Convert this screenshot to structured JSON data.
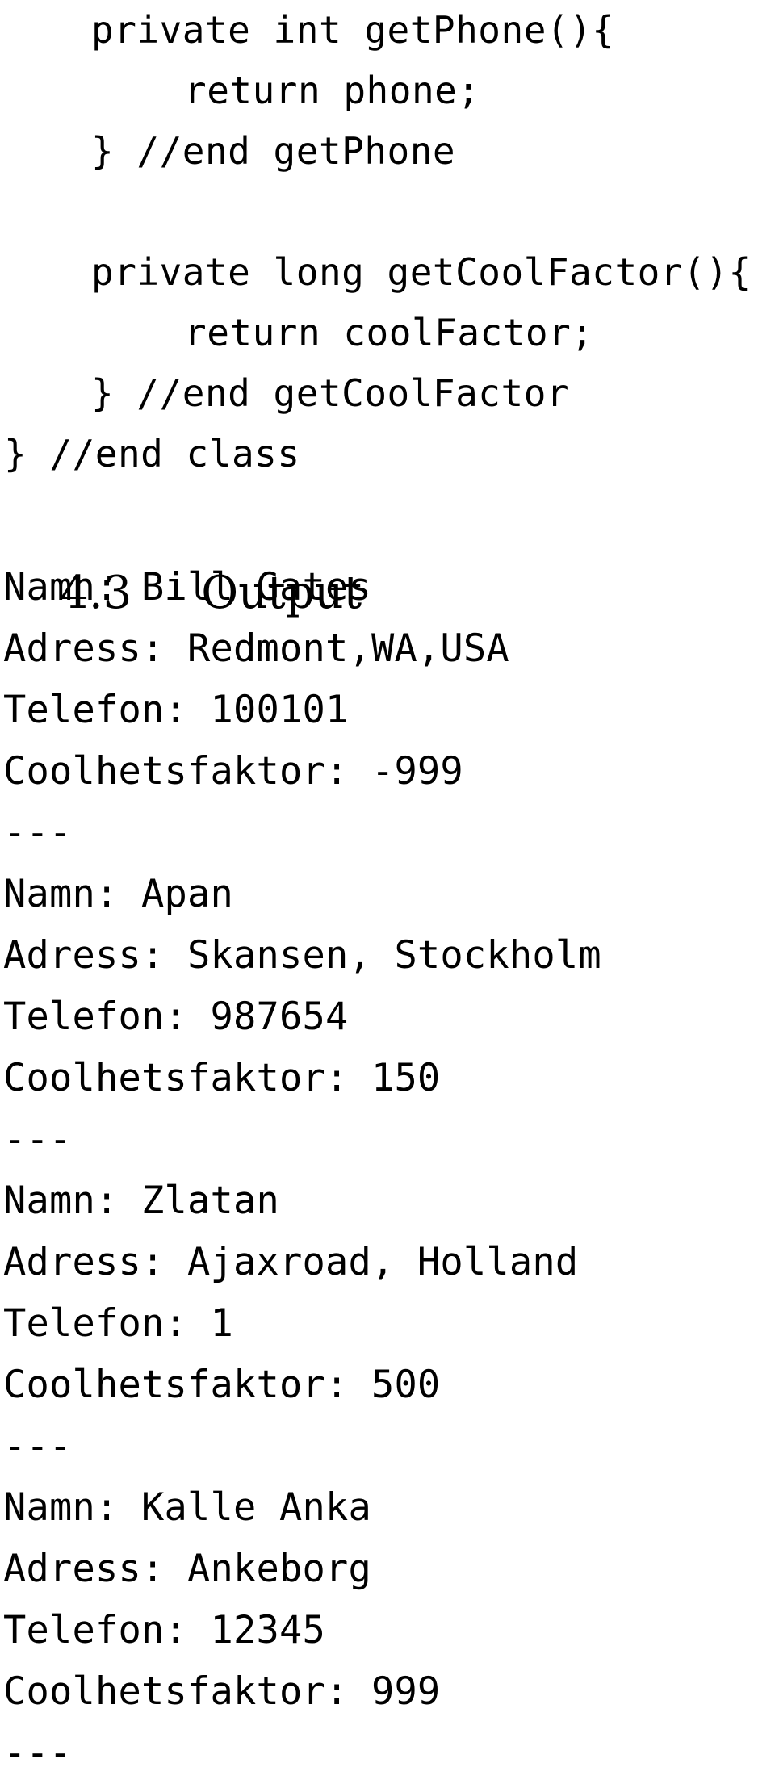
{
  "document": {
    "page_background": "#ffffff",
    "text_color": "#000000"
  },
  "code_listing": {
    "lines": [
      {
        "text": "private int getPhone(){",
        "indent": 1
      },
      {
        "text": "return phone;",
        "indent": 2
      },
      {
        "text": "} //end getPhone",
        "indent": 1
      },
      {
        "text": "",
        "indent": 1
      },
      {
        "text": "private long getCoolFactor(){",
        "indent": 1
      },
      {
        "text": "return coolFactor;",
        "indent": 2
      },
      {
        "text": "} //end getCoolFactor",
        "indent": 1
      },
      {
        "text": "} //end class",
        "indent": 0
      }
    ]
  },
  "heading": {
    "number": "4.3",
    "title": "Output"
  },
  "output": {
    "separator": "---",
    "labels": {
      "name": "Namn:",
      "address": "Adress:",
      "phone": "Telefon:",
      "coolfactor": "Coolhetsfaktor:"
    },
    "lines": [
      "Namn: Bill Gates",
      "Adress: Redmont,WA,USA",
      "Telefon: 100101",
      "Coolhetsfaktor: -999",
      "---",
      "Namn: Apan",
      "Adress: Skansen, Stockholm",
      "Telefon: 987654",
      "Coolhetsfaktor: 150",
      "---",
      "Namn: Zlatan",
      "Adress: Ajaxroad, Holland",
      "Telefon: 1",
      "Coolhetsfaktor: 500",
      "---",
      "Namn: Kalle Anka",
      "Adress: Ankeborg",
      "Telefon: 12345",
      "Coolhetsfaktor: 999",
      "---"
    ],
    "records": [
      {
        "name": "Bill Gates",
        "address": "Redmont,WA,USA",
        "phone": "100101",
        "coolfactor": "-999"
      },
      {
        "name": "Apan",
        "address": "Skansen, Stockholm",
        "phone": "987654",
        "coolfactor": "150"
      },
      {
        "name": "Zlatan",
        "address": "Ajaxroad, Holland",
        "phone": "1",
        "coolfactor": "500"
      },
      {
        "name": "Kalle Anka",
        "address": "Ankeborg",
        "phone": "12345",
        "coolfactor": "999"
      }
    ]
  }
}
